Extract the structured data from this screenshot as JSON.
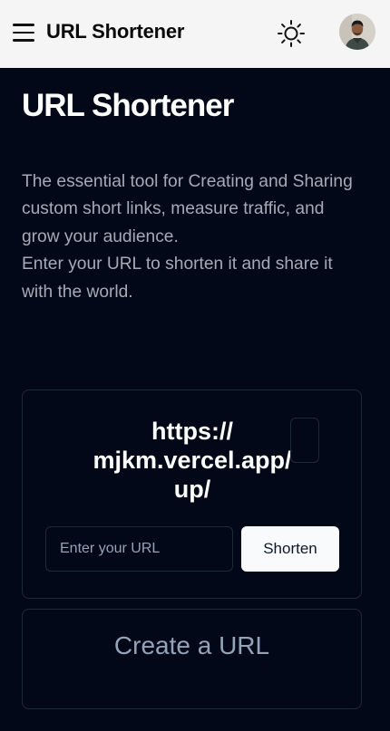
{
  "header": {
    "brand": "URL Shortener",
    "menu_icon": "hamburger-menu-icon",
    "theme_icon": "sun-icon",
    "avatar_alt": "user-avatar"
  },
  "hero": {
    "title": "URL Shortener",
    "description_line1": "The essential tool for Creating and Sharing custom short links, measure traffic, and grow your audience.",
    "description_line2": "Enter your URL to shorten it and share it with the world."
  },
  "shortener": {
    "short_url_line1": "https://",
    "short_url_line2": "mjkm.vercel.app/",
    "short_url_line3": "up/",
    "input_value": "",
    "input_placeholder": "Enter your URL",
    "button_label": "Shorten"
  },
  "create": {
    "title": "Create a URL"
  },
  "colors": {
    "background": "#020817",
    "header_bg": "#f5f5f5",
    "border": "#1e293b",
    "muted_text": "#94a3b8",
    "button_bg": "#f8fafc"
  }
}
